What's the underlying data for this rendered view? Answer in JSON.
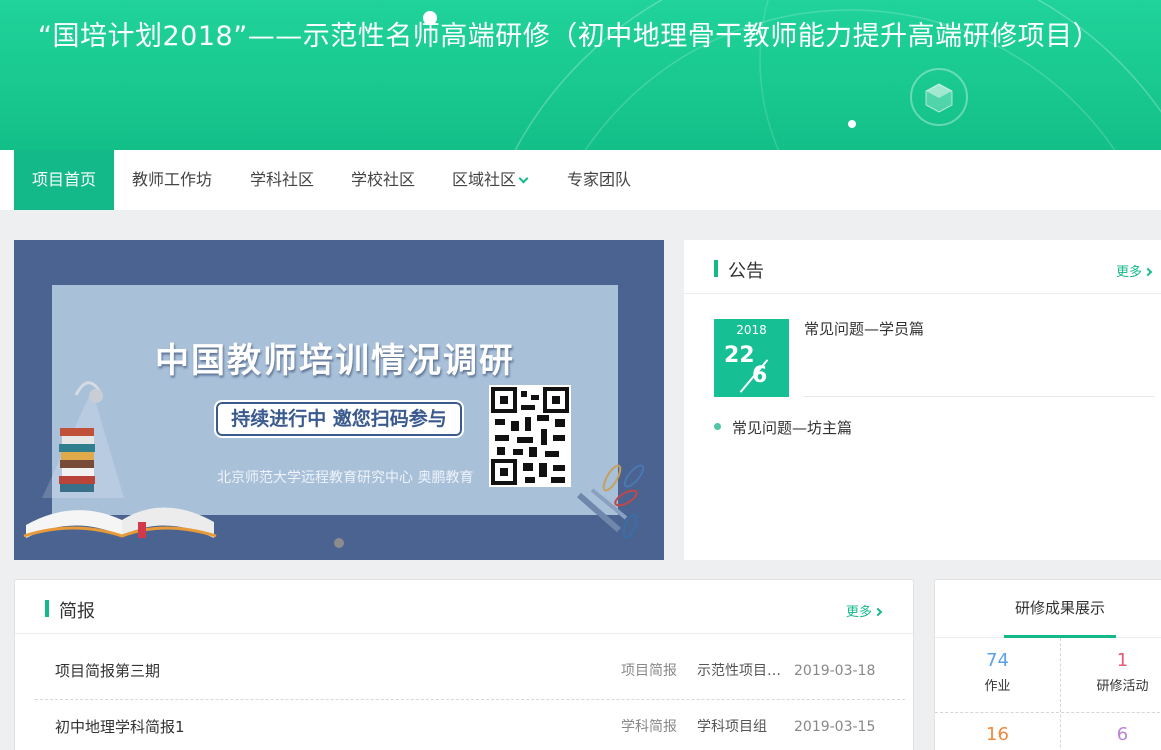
{
  "header": {
    "title": "“国培计划2018”——示范性名师高端研修（初中地理骨干教师能力提升高端研修项目）",
    "cube_icon": "cube-icon"
  },
  "nav": {
    "items": [
      {
        "label": "项目首页",
        "active": true
      },
      {
        "label": "教师工作坊"
      },
      {
        "label": "学科社区"
      },
      {
        "label": "学校社区"
      },
      {
        "label": "区域社区"
      },
      {
        "label": "专家团队"
      }
    ]
  },
  "banner": {
    "heading": "中国教师培训情况调研",
    "pill": "持续进行中  邀您扫码参与",
    "org": "北京师范大学远程教育研究中心  奥鹏教育"
  },
  "notice": {
    "title": "公告",
    "more": "更多",
    "date": {
      "year": "2018",
      "day": "22",
      "month": "6"
    },
    "items": [
      "常见问题—学员篇",
      "常见问题—坊主篇"
    ]
  },
  "brief": {
    "title": "简报",
    "more": "更多",
    "rows": [
      {
        "name": "项目简报第三期",
        "category": "项目简报",
        "group": "示范性项目…",
        "date": "2019-03-18"
      },
      {
        "name": "初中地理学科简报1",
        "category": "学科简报",
        "group": "学科项目组",
        "date": "2019-03-15"
      }
    ]
  },
  "results": {
    "title": "研修成果展示",
    "stats": [
      {
        "value": "74",
        "label": "作业",
        "color": "#5aa0e6"
      },
      {
        "value": "1",
        "label": "研修活动",
        "color": "#e85a7a"
      },
      {
        "value": "16",
        "label": "",
        "color": "#f08a3c"
      },
      {
        "value": "6",
        "label": "",
        "color": "#b884d8"
      }
    ]
  },
  "colors": {
    "accent": "#14b98a",
    "header": "#19c98f",
    "banner_bg": "#4a6390"
  }
}
